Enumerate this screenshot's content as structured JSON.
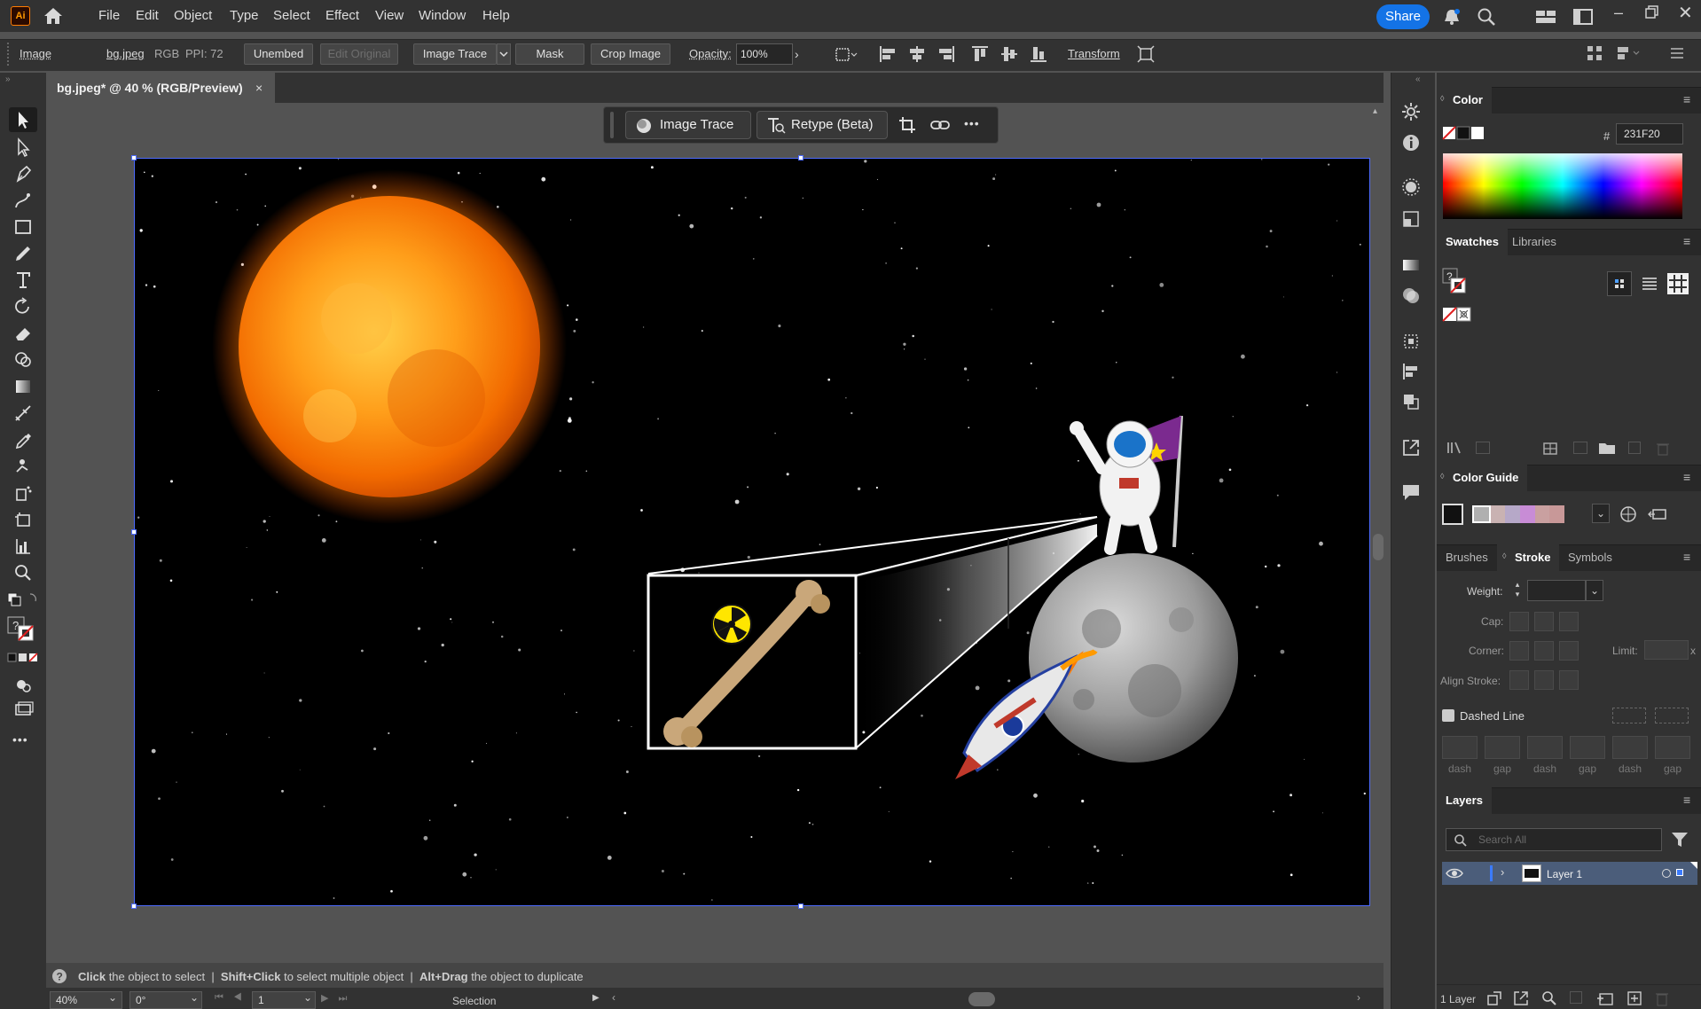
{
  "menubar": {
    "app_icon_text": "Ai",
    "items": [
      "File",
      "Edit",
      "Object",
      "Type",
      "Select",
      "Effect",
      "View",
      "Window",
      "Help"
    ],
    "share_label": "Share"
  },
  "controlbar": {
    "object_type": "Image",
    "file_link": "bg.jpeg",
    "color_mode": "RGB",
    "ppi": "PPI: 72",
    "unembed": "Unembed",
    "edit_original": "Edit Original",
    "image_trace": "Image Trace",
    "mask": "Mask",
    "crop_image": "Crop Image",
    "opacity_label": "Opacity:",
    "opacity_value": "100%",
    "transform": "Transform"
  },
  "document": {
    "tab_title": "bg.jpeg* @ 40 % (RGB/Preview)",
    "close": "×"
  },
  "context_bar": {
    "image_trace": "Image Trace",
    "retype": "Retype (Beta)",
    "more": "•••"
  },
  "statusbar": {
    "hint_click": "Click",
    "hint_1": " the object to select  |  ",
    "hint_shift": "Shift+Click",
    "hint_2": " to select multiple object  |  ",
    "hint_alt": "Alt+Drag",
    "hint_3": " the object to duplicate",
    "zoom": "40%",
    "rotation": "0°",
    "artboard": "1",
    "tool_name": "Selection"
  },
  "color_panel": {
    "title": "Color",
    "hex_label": "#",
    "hex_value": "231F20"
  },
  "swatches_panel": {
    "tabs": [
      "Swatches",
      "Libraries"
    ],
    "unknown_swatch": "?"
  },
  "color_guide_panel": {
    "title": "Color Guide",
    "guide_colors": [
      "#b0b0b0",
      "#c9b2b2",
      "#b6a8c8",
      "#c88cd6",
      "#c9a0a0",
      "#c89898"
    ]
  },
  "stroke_panel": {
    "tabs": [
      "Brushes",
      "Stroke",
      "Symbols"
    ],
    "weight_label": "Weight:",
    "cap_label": "Cap:",
    "corner_label": "Corner:",
    "limit_label": "Limit:",
    "limit_suffix": "x",
    "align_label": "Align Stroke:",
    "dashed_label": "Dashed Line",
    "dash_labels": [
      "dash",
      "gap",
      "dash",
      "gap",
      "dash",
      "gap"
    ]
  },
  "layers_panel": {
    "title": "Layers",
    "search_placeholder": "Search All",
    "layer_name": "Layer 1",
    "footer_count": "1 Layer"
  },
  "colors": {
    "accent": "#1473e6",
    "selection": "#4d6bff",
    "layer_selected": "#4b5d7a"
  },
  "artwork": {
    "description_icons": [
      "sun",
      "moon",
      "astronaut-with-flag",
      "rocket",
      "bone",
      "radiation-symbol",
      "magnifying-frame"
    ]
  }
}
